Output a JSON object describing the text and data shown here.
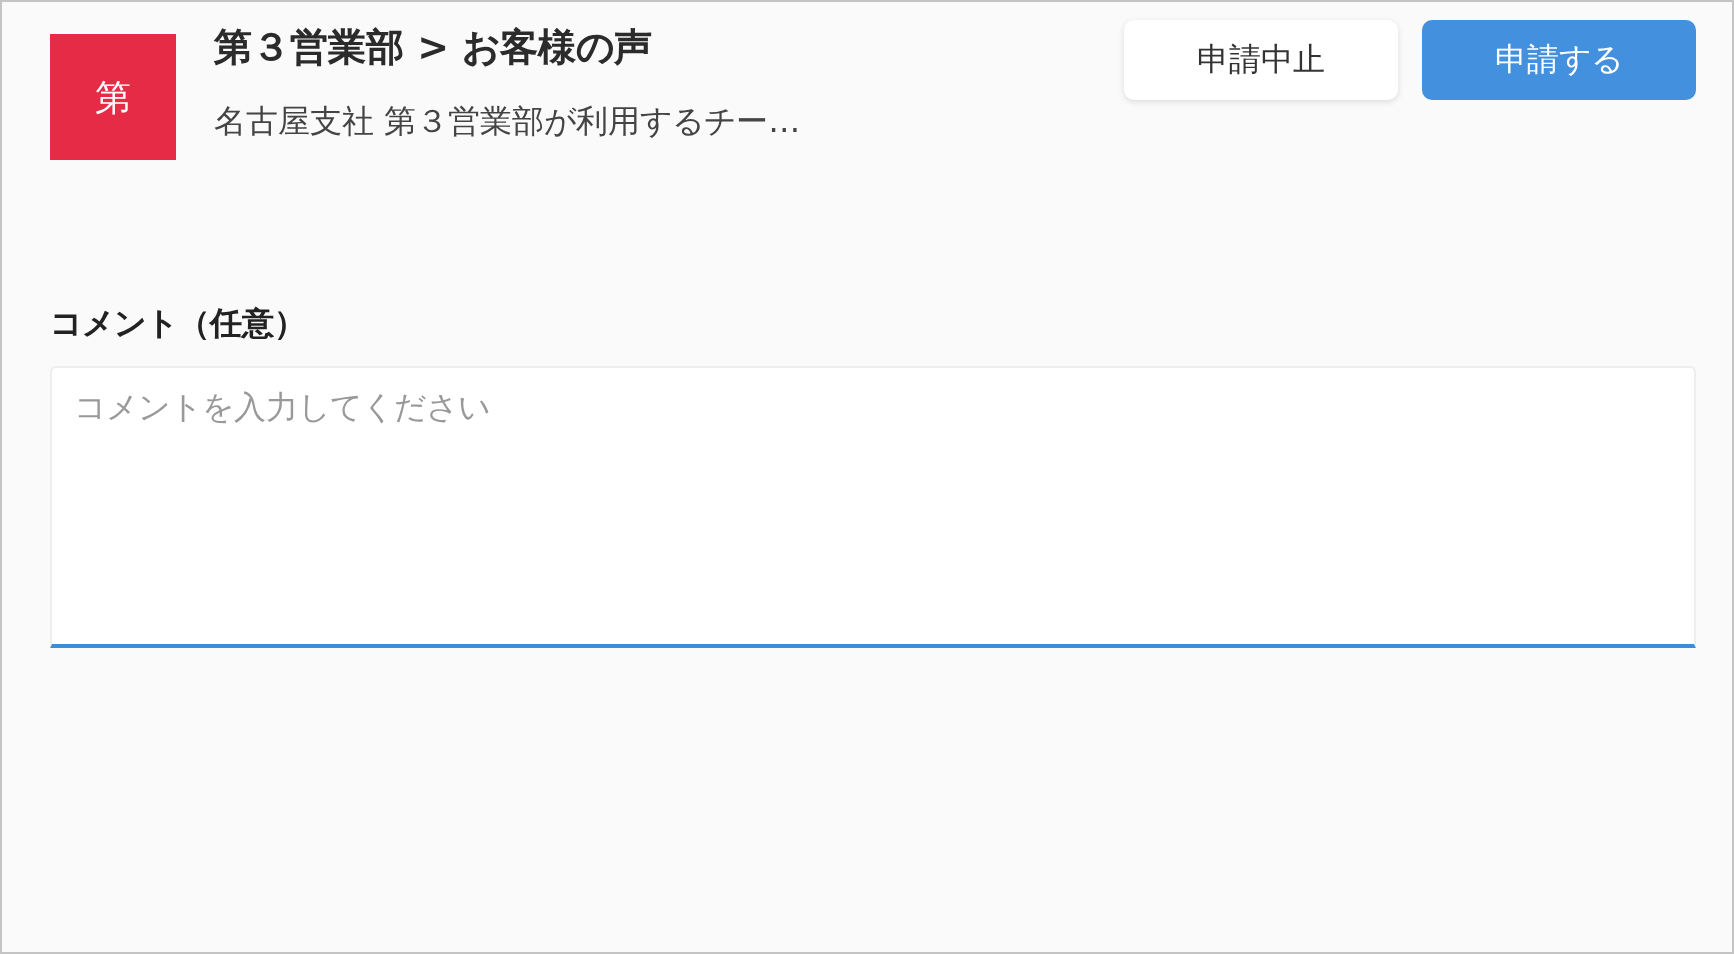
{
  "header": {
    "avatar": "第",
    "title": "第３営業部 > お客様の声",
    "subtitle": "名古屋支社 第３営業部が利用するチー…"
  },
  "buttons": [
    {
      "label": "申請中止",
      "kind": "secondary"
    },
    {
      "label": "申請する",
      "kind": "primary"
    }
  ],
  "comment": {
    "label": "コメント（任意）",
    "placeholder": "コメントを入力してください"
  }
}
